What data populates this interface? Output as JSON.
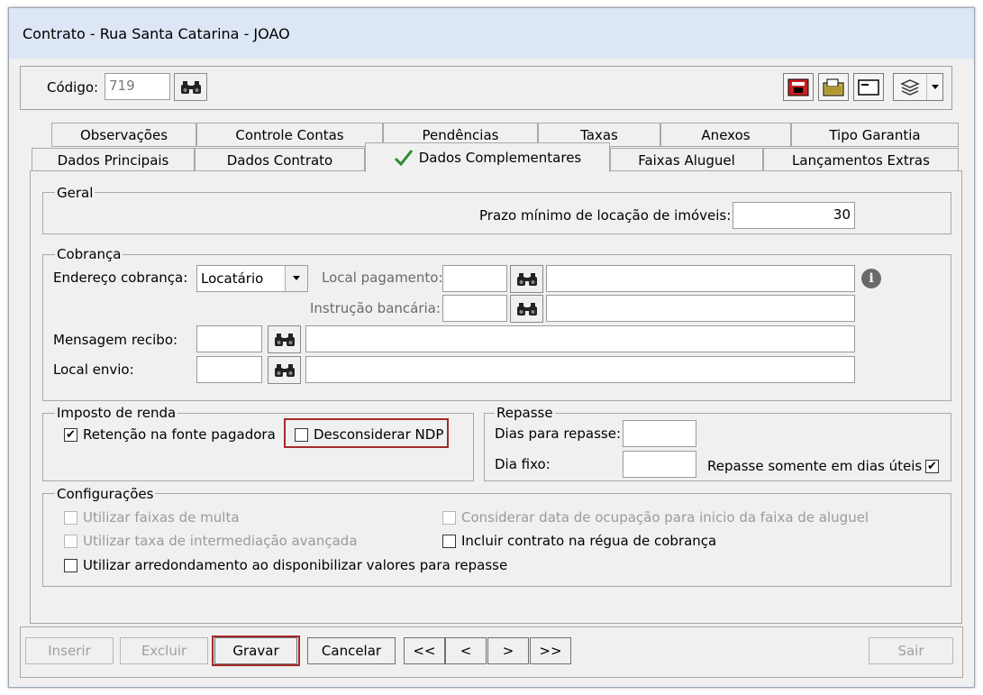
{
  "window": {
    "title": "Contrato - Rua Santa Catarina - JOAO"
  },
  "header": {
    "codigo_label": "Código:",
    "codigo_value": "719",
    "tools": [
      "phone-icon",
      "folder-icon",
      "card-icon",
      "layers-icon",
      "chevron-down-icon"
    ]
  },
  "tabs": {
    "row1": [
      "Observações",
      "Controle Contas",
      "Pendências",
      "Taxas",
      "Anexos",
      "Tipo Garantia"
    ],
    "row2": [
      "Dados Principais",
      "Dados Contrato",
      "Dados Complementares",
      "Faixas Aluguel",
      "Lançamentos Extras"
    ],
    "active": "Dados Complementares"
  },
  "geral": {
    "title": "Geral",
    "prazo_label": "Prazo mínimo de locação de imóveis:",
    "prazo_value": "30"
  },
  "cobranca": {
    "title": "Cobrança",
    "endereco_label": "Endereço cobrança:",
    "endereco_value": "Locatário",
    "local_pagamento_label": "Local pagamento:",
    "instrucao_label": "Instrução bancária:",
    "mensagem_label": "Mensagem recibo:",
    "local_envio_label": "Local envio:"
  },
  "imposto": {
    "title": "Imposto de renda",
    "retencao_label": "Retenção na fonte pagadora",
    "retencao_checked": true,
    "desconsiderar_label": "Desconsiderar NDP",
    "desconsiderar_checked": false
  },
  "repasse": {
    "title": "Repasse",
    "dias_label": "Dias para repasse:",
    "dia_fixo_label": "Dia fixo:",
    "somente_uteis_label": "Repasse somente em dias úteis",
    "somente_uteis_checked": true
  },
  "config": {
    "title": "Configurações",
    "faixas_multa": "Utilizar faixas de multa",
    "taxa_intermediacao": "Utilizar taxa de intermediação avançada",
    "arredondamento": "Utilizar arredondamento ao disponibilizar valores para repasse",
    "considerar_data": "Considerar data de ocupação para inicio da faixa de aluguel",
    "incluir_regua": "Incluir contrato na régua de cobrança"
  },
  "buttons": {
    "inserir": "Inserir",
    "excluir": "Excluir",
    "gravar": "Gravar",
    "cancelar": "Cancelar",
    "first": "<<",
    "prev": "<",
    "next": ">",
    "last": ">>",
    "sair": "Sair"
  },
  "colors": {
    "highlight": "#a52a2a",
    "titlebar": "#dce6f4",
    "check_green": "#2e8b2e"
  }
}
